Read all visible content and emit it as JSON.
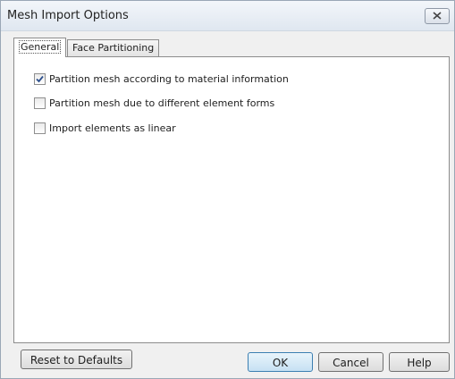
{
  "window": {
    "title": "Mesh Import Options"
  },
  "tabs": [
    {
      "label": "General",
      "active": true
    },
    {
      "label": "Face Partitioning",
      "active": false
    }
  ],
  "options": [
    {
      "label": "Partition mesh according to material information",
      "checked": true
    },
    {
      "label": "Partition mesh due to different element forms",
      "checked": false
    },
    {
      "label": "Import elements as linear",
      "checked": false
    }
  ],
  "buttons": {
    "reset": "Reset to Defaults",
    "ok": "OK",
    "cancel": "Cancel",
    "help": "Help"
  },
  "colors": {
    "check": "#2c4f8c",
    "panel_border": "#8c8c8c"
  }
}
